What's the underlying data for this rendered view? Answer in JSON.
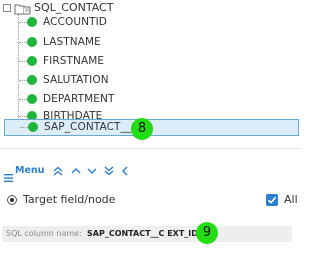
{
  "tree": {
    "root_label": "SQL_CONTACT",
    "items": [
      {
        "label": "ACCOUNTID"
      },
      {
        "label": "LASTNAME"
      },
      {
        "label": "FIRSTNAME"
      },
      {
        "label": "SALUTATION"
      },
      {
        "label": "DEPARTMENT"
      },
      {
        "label": "BIRTHDATE"
      },
      {
        "label": "SAP_CONTACT__C",
        "selected": true
      }
    ],
    "status_color": "#1fb53a",
    "selection_color": "#dcecf8"
  },
  "callouts": {
    "first": "8",
    "second": "9"
  },
  "toolbar": {
    "menu_label": "Menu",
    "icons": [
      "menu-icon",
      "double-up-icon",
      "up-icon",
      "down-icon",
      "double-down-icon",
      "collapse-left-icon"
    ],
    "accent_color": "#2b7fcf"
  },
  "target": {
    "label": "Target field/node",
    "all_label": "All",
    "all_checked": true
  },
  "sql_field": {
    "prefix": "SQL column name:",
    "value": "SAP_CONTACT__C EXT_ID"
  }
}
